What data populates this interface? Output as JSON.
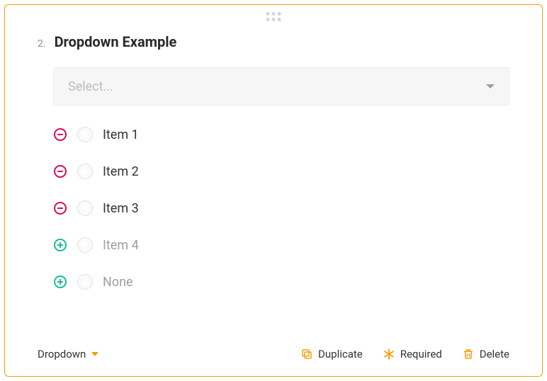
{
  "question": {
    "number": "2.",
    "title": "Dropdown Example"
  },
  "select": {
    "placeholder": "Select..."
  },
  "options": [
    {
      "label": "Item 1",
      "mode": "remove",
      "muted": false
    },
    {
      "label": "Item 2",
      "mode": "remove",
      "muted": false
    },
    {
      "label": "Item 3",
      "mode": "remove",
      "muted": false
    },
    {
      "label": "Item 4",
      "mode": "add",
      "muted": true
    },
    {
      "label": "None",
      "mode": "add",
      "muted": true
    }
  ],
  "footer": {
    "type_label": "Dropdown",
    "duplicate": "Duplicate",
    "required": "Required",
    "delete": "Delete"
  },
  "colors": {
    "accent": "#f59e0b",
    "remove": "#d90b55",
    "add": "#1abc9c"
  }
}
